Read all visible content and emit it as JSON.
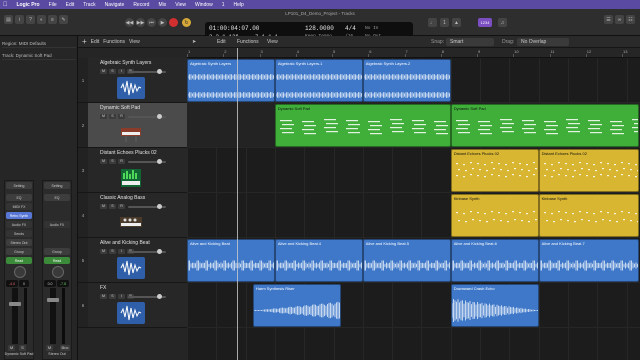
{
  "menubar": {
    "items": [
      "Logic Pro",
      "File",
      "Edit",
      "Track",
      "Navigate",
      "Record",
      "Mix",
      "View",
      "Window",
      "1",
      "Help"
    ]
  },
  "window_title": "LP101_D4_Demo_Project - Tracks",
  "lcd": {
    "position_time": "01:00:04:07.00",
    "position_bars": "3  2  1  126",
    "tempo": "128.0000",
    "tempo_label": "Keep Tempo",
    "signature": "4/4",
    "division": "/16",
    "in_label": "No In",
    "out_label": "No Out",
    "end_bars": "7  1  1  1"
  },
  "toolbar": {
    "cpu_badge": "1234"
  },
  "inspector": {
    "region_label": "Region: MIDI Defaults",
    "track_label": "Track: Dynamic Soft Pad",
    "strip_left": {
      "setting": "Setting",
      "eq": "EQ",
      "midi_fx": "MIDI FX",
      "instrument": "Retro Synth",
      "audio_fx": "Audio FX",
      "sends": "Sends",
      "output": "Stereo Out",
      "group": "Group",
      "automation": "Read",
      "volume": "-4.0",
      "pan": "0",
      "name": "Dynamic Soft Pad"
    },
    "strip_right": {
      "setting": "Setting",
      "eq": "EQ",
      "audio_fx": "Audio FX",
      "group": "Group",
      "automation": "Read",
      "volume": "0.0",
      "pan": "-7.8",
      "name": "Stereo Out",
      "bounce": "Bnc"
    }
  },
  "tracks_header": {
    "edit": "Edit",
    "functions": "Functions",
    "view": "View"
  },
  "arrange_header": {
    "edit": "Edit",
    "functions": "Functions",
    "view": "View",
    "snap_label": "Snap:",
    "snap_value": "Smart",
    "drag_label": "Drag:",
    "drag_value": "No Overlap"
  },
  "ruler": [
    "1",
    "2",
    "3",
    "4",
    "5",
    "6",
    "7",
    "8",
    "9",
    "10",
    "11",
    "12",
    "13"
  ],
  "tracks": [
    {
      "num": "1",
      "name": "Algebraic Synth Layers",
      "type": "audio",
      "color": "#3f78c9"
    },
    {
      "num": "2",
      "name": "Dynamic Soft Pad",
      "type": "midi",
      "color": "#3faf3a"
    },
    {
      "num": "3",
      "name": "Distant Echoes Plucks 02",
      "type": "midi",
      "color": "#d9b631"
    },
    {
      "num": "4",
      "name": "Classic Analog Bass",
      "type": "midi",
      "color": "#d9b631"
    },
    {
      "num": "5",
      "name": "Alive and Kicking Beat",
      "type": "audio",
      "color": "#3f78c9"
    },
    {
      "num": "6",
      "name": "FX",
      "type": "audio",
      "color": "#3f78c9"
    }
  ],
  "track_buttons": {
    "mute": "M",
    "solo": "S",
    "rec": "R",
    "input": "I"
  },
  "regions": [
    {
      "track": 0,
      "name": "Algebraic Synth Layers",
      "start": 0,
      "len": 3,
      "kind": "audio"
    },
    {
      "track": 0,
      "name": "Algebraic Synth Layers.1",
      "start": 3,
      "len": 3,
      "kind": "audio"
    },
    {
      "track": 0,
      "name": "Algebraic Synth Layers.2",
      "start": 6,
      "len": 3,
      "kind": "audio"
    },
    {
      "track": 1,
      "name": "Dynamic Soft Pad",
      "start": 3,
      "len": 6,
      "kind": "midi"
    },
    {
      "track": 1,
      "name": "Dynamic Soft Pad",
      "start": 9,
      "len": 6.5,
      "kind": "midi"
    },
    {
      "track": 2,
      "name": "Distant Echoes Plucks 02",
      "start": 9,
      "len": 3,
      "kind": "midi"
    },
    {
      "track": 2,
      "name": "Distant Echoes Plucks 02",
      "start": 12,
      "len": 3.5,
      "kind": "midi"
    },
    {
      "track": 3,
      "name": "Kinbase Synth",
      "start": 9,
      "len": 3,
      "kind": "midi"
    },
    {
      "track": 3,
      "name": "Kinbase Synth",
      "start": 12,
      "len": 3.5,
      "kind": "midi"
    },
    {
      "track": 4,
      "name": "Alive and Kicking Beat",
      "start": 0,
      "len": 3,
      "kind": "audio"
    },
    {
      "track": 4,
      "name": "Alive and Kicking Beat.4",
      "start": 3,
      "len": 3,
      "kind": "audio"
    },
    {
      "track": 4,
      "name": "Alive and Kicking Beat.5",
      "start": 6,
      "len": 3,
      "kind": "audio"
    },
    {
      "track": 4,
      "name": "Alive and Kicking Beat.6",
      "start": 9,
      "len": 3,
      "kind": "audio"
    },
    {
      "track": 4,
      "name": "Alive and Kicking Beat.7",
      "start": 12,
      "len": 3.5,
      "kind": "audio"
    },
    {
      "track": 5,
      "name": "Harm Synthesis Riser",
      "start": 2.25,
      "len": 3,
      "kind": "audio"
    },
    {
      "track": 5,
      "name": "Downward Crash Echo",
      "start": 9,
      "len": 3,
      "kind": "audio"
    }
  ],
  "colors": {
    "audio": "#3f78c9",
    "midi_green": "#3faf3a",
    "midi_yellow": "#d9b631",
    "menubar": "#5b4aa2"
  }
}
